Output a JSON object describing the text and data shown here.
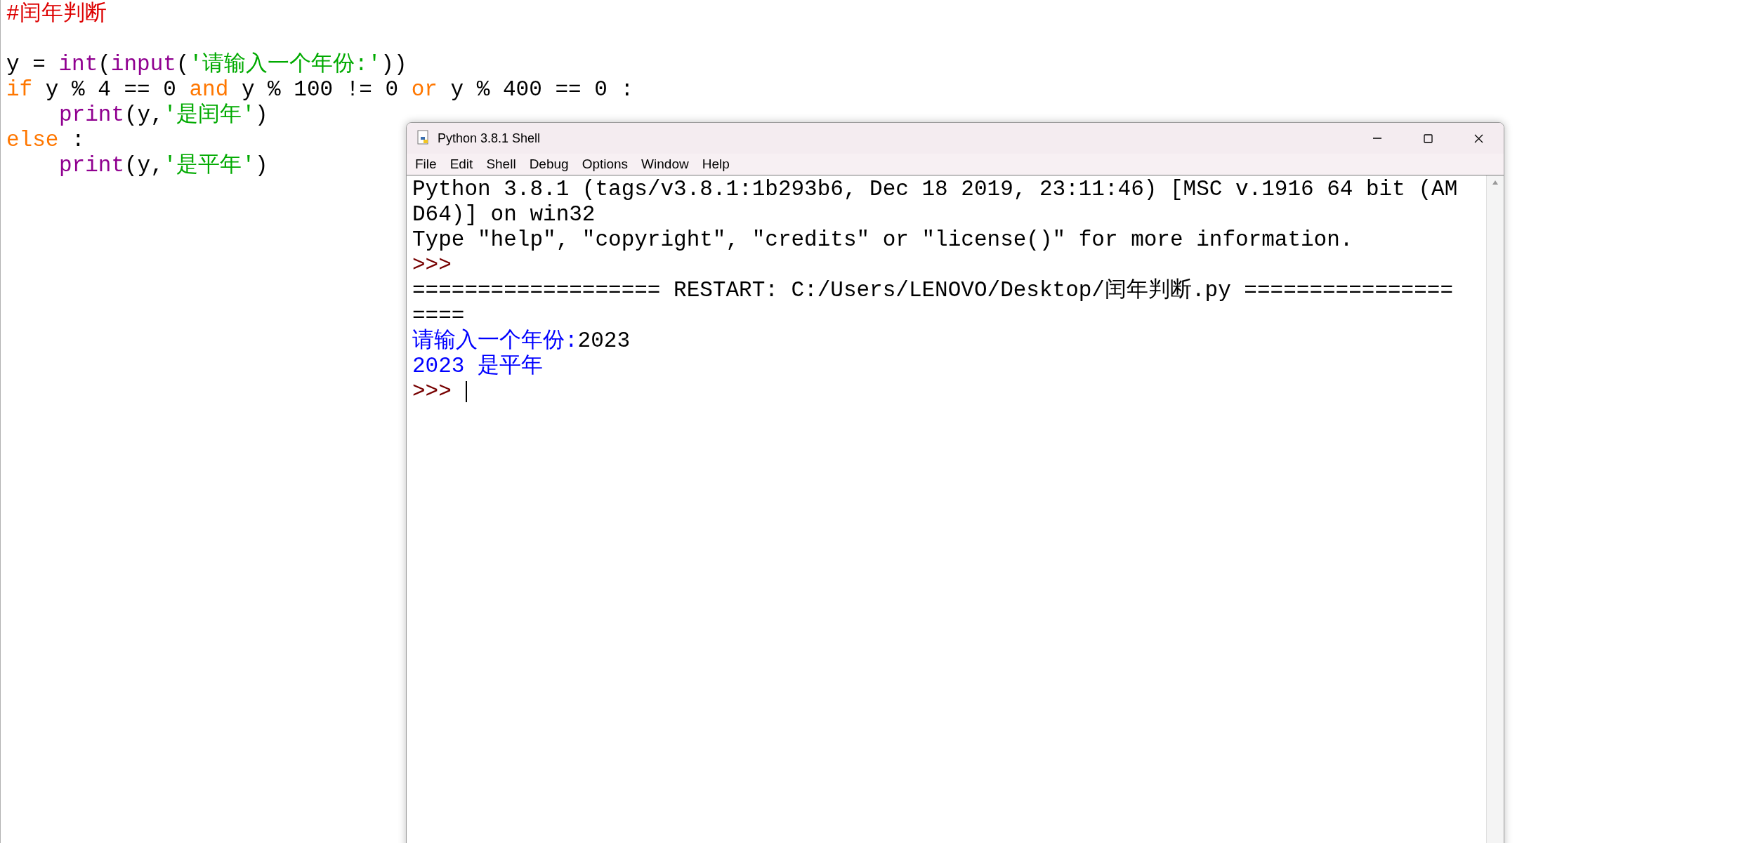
{
  "editor": {
    "lines": [
      {
        "kind": "line",
        "tokens": [
          {
            "kind": "comment",
            "text": "#闰年判断"
          }
        ]
      },
      {
        "kind": "blank"
      },
      {
        "kind": "line",
        "tokens": [
          {
            "kind": "plain",
            "text": "y = "
          },
          {
            "kind": "builtin",
            "text": "int"
          },
          {
            "kind": "plain",
            "text": "("
          },
          {
            "kind": "builtin",
            "text": "input"
          },
          {
            "kind": "plain",
            "text": "("
          },
          {
            "kind": "string",
            "text": "'请输入一个年份:'"
          },
          {
            "kind": "plain",
            "text": "))"
          }
        ]
      },
      {
        "kind": "line",
        "tokens": [
          {
            "kind": "keyword",
            "text": "if"
          },
          {
            "kind": "plain",
            "text": " y % 4 == 0 "
          },
          {
            "kind": "keyword",
            "text": "and"
          },
          {
            "kind": "plain",
            "text": " y % 100 != 0 "
          },
          {
            "kind": "keyword",
            "text": "or"
          },
          {
            "kind": "plain",
            "text": " y % 400 == 0 :"
          }
        ]
      },
      {
        "kind": "indented",
        "tokens": [
          {
            "kind": "builtin",
            "text": "print"
          },
          {
            "kind": "plain",
            "text": "(y,"
          },
          {
            "kind": "string",
            "text": "'是闰年'"
          },
          {
            "kind": "plain",
            "text": ")"
          }
        ]
      },
      {
        "kind": "line",
        "tokens": [
          {
            "kind": "keyword",
            "text": "else"
          },
          {
            "kind": "plain",
            "text": " :"
          }
        ]
      },
      {
        "kind": "indented",
        "tokens": [
          {
            "kind": "builtin",
            "text": "print"
          },
          {
            "kind": "plain",
            "text": "(y,"
          },
          {
            "kind": "string",
            "text": "'是平年'"
          },
          {
            "kind": "plain",
            "text": ")"
          }
        ]
      }
    ]
  },
  "shell": {
    "title": "Python 3.8.1 Shell",
    "menu": [
      "File",
      "Edit",
      "Shell",
      "Debug",
      "Options",
      "Window",
      "Help"
    ],
    "lines": [
      [
        {
          "kind": "output",
          "text": "Python 3.8.1 (tags/v3.8.1:1b293b6, Dec 18 2019, 23:11:46) [MSC v.1916 64 bit (AM"
        }
      ],
      [
        {
          "kind": "output",
          "text": "D64)] on win32"
        }
      ],
      [
        {
          "kind": "output",
          "text": "Type \"help\", \"copyright\", \"credits\" or \"license()\" for more information."
        }
      ],
      [
        {
          "kind": "prompt",
          "text": ">>>"
        }
      ],
      [
        {
          "kind": "output",
          "text": "=================== RESTART: C:/Users/LENOVO/Desktop/闰年判断.py ================"
        }
      ],
      [
        {
          "kind": "output",
          "text": "===="
        }
      ],
      [
        {
          "kind": "stdout",
          "text": "请输入一个年份:"
        },
        {
          "kind": "input",
          "text": "2023"
        }
      ],
      [
        {
          "kind": "stdout",
          "text": "2023 是平年"
        }
      ],
      [
        {
          "kind": "prompt",
          "text": ">>> "
        }
      ]
    ]
  }
}
